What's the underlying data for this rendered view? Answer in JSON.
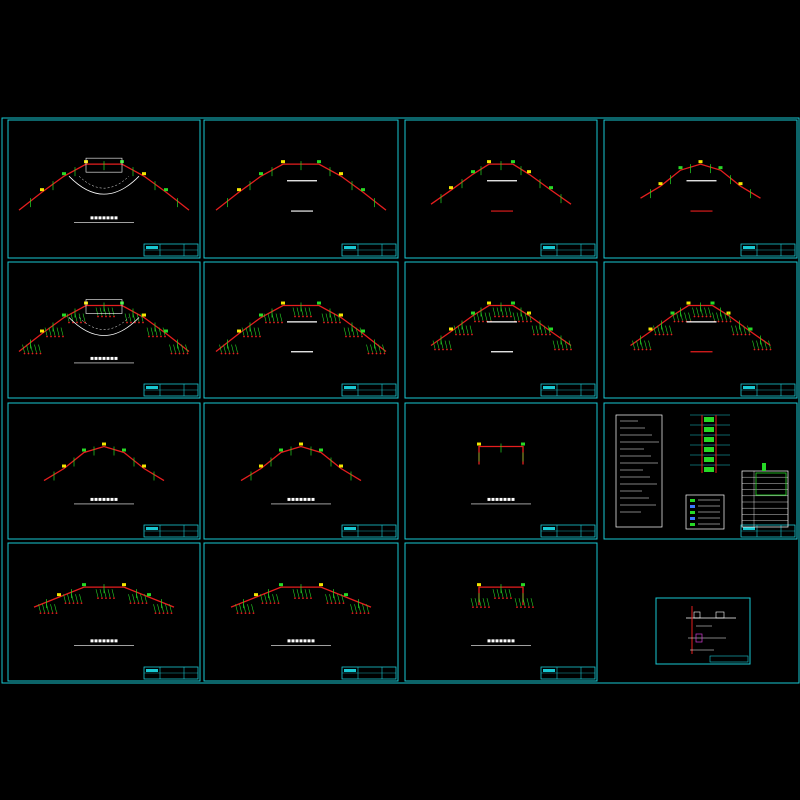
{
  "canvas": {
    "background": "#000000"
  },
  "colors": {
    "frame": "#19c8d2",
    "wall": "#e61e1e",
    "fixture": "#26d926",
    "lamp": "#f2e600",
    "text": "#ffffff",
    "magenta": "#d23cd2",
    "blue": "#3c78ff"
  },
  "sheets": [
    {
      "id": "sheet-1",
      "plan": "arc-wide",
      "has_stage": true,
      "has_label": true,
      "has_blocks": false
    },
    {
      "id": "sheet-2",
      "plan": "arc-wide",
      "has_stage": false,
      "has_label": false,
      "has_blocks": true
    },
    {
      "id": "sheet-3",
      "plan": "arc-medium",
      "has_stage": false,
      "has_label": false,
      "has_blocks": true
    },
    {
      "id": "sheet-4",
      "plan": "arc-small",
      "has_stage": false,
      "has_label": false,
      "has_blocks": true
    },
    {
      "id": "sheet-5",
      "plan": "fixtures-wide",
      "has_stage": true,
      "has_label": true,
      "has_blocks": false
    },
    {
      "id": "sheet-6",
      "plan": "fixtures-wide",
      "has_stage": false,
      "has_label": false,
      "has_blocks": true
    },
    {
      "id": "sheet-7",
      "plan": "fixtures-medium",
      "has_stage": false,
      "has_label": false,
      "has_blocks": true
    },
    {
      "id": "sheet-8",
      "plan": "fixtures-medium",
      "has_stage": false,
      "has_label": false,
      "has_blocks": true
    },
    {
      "id": "sheet-9",
      "plan": "arc-small",
      "has_stage": false,
      "has_label": true,
      "has_blocks": false
    },
    {
      "id": "sheet-10",
      "plan": "arc-small",
      "has_stage": false,
      "has_label": true,
      "has_blocks": false
    },
    {
      "id": "sheet-11",
      "plan": "straight",
      "has_stage": false,
      "has_label": true,
      "has_blocks": false
    },
    {
      "id": "sheet-12",
      "plan": "system-diagram",
      "has_stage": false,
      "has_label": false,
      "has_blocks": false
    },
    {
      "id": "sheet-13",
      "plan": "fixtures-flat",
      "has_stage": false,
      "has_label": true,
      "has_blocks": false
    },
    {
      "id": "sheet-14",
      "plan": "fixtures-flat",
      "has_stage": false,
      "has_label": true,
      "has_blocks": false
    },
    {
      "id": "sheet-15",
      "plan": "straight-fixtures",
      "has_stage": false,
      "has_label": true,
      "has_blocks": false
    }
  ],
  "detail_sheet": {
    "id": "sheet-16",
    "plan": "detail"
  }
}
